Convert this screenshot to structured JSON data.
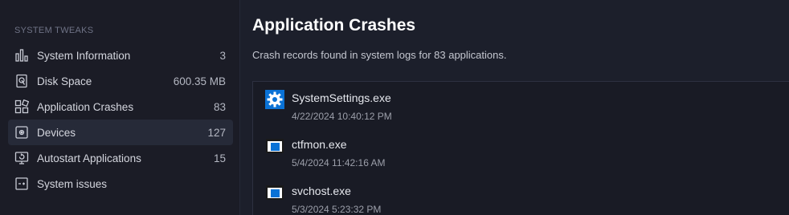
{
  "sidebar": {
    "title": "SYSTEM TWEAKS",
    "items": [
      {
        "label": "System Information",
        "count": "3",
        "icon": "bar-chart-icon"
      },
      {
        "label": "Disk Space",
        "count": "600.35 MB",
        "icon": "disk-icon"
      },
      {
        "label": "Application Crashes",
        "count": "83",
        "icon": "apps-broken-icon"
      },
      {
        "label": "Devices",
        "count": "127",
        "icon": "devices-icon"
      },
      {
        "label": "Autostart Applications",
        "count": "15",
        "icon": "autostart-icon"
      },
      {
        "label": "System issues",
        "count": "",
        "icon": "system-issues-icon"
      }
    ],
    "active_index": 3
  },
  "main": {
    "title": "Application Crashes",
    "subtitle": "Crash records found in system logs for 83 applications.",
    "crashes": [
      {
        "name": "SystemSettings.exe",
        "time": "4/22/2024 10:40:12 PM",
        "icon": "gear-icon"
      },
      {
        "name": "ctfmon.exe",
        "time": "5/4/2024 11:42:16 AM",
        "icon": "window-app-icon"
      },
      {
        "name": "svchost.exe",
        "time": "5/3/2024 5:23:32 PM",
        "icon": "window-app-icon"
      }
    ]
  },
  "colors": {
    "sidebar_bg": "#1b1c26",
    "main_bg": "#1c1f2b",
    "active_item_bg": "#262a38",
    "accent_blue": "#0a72d6"
  }
}
